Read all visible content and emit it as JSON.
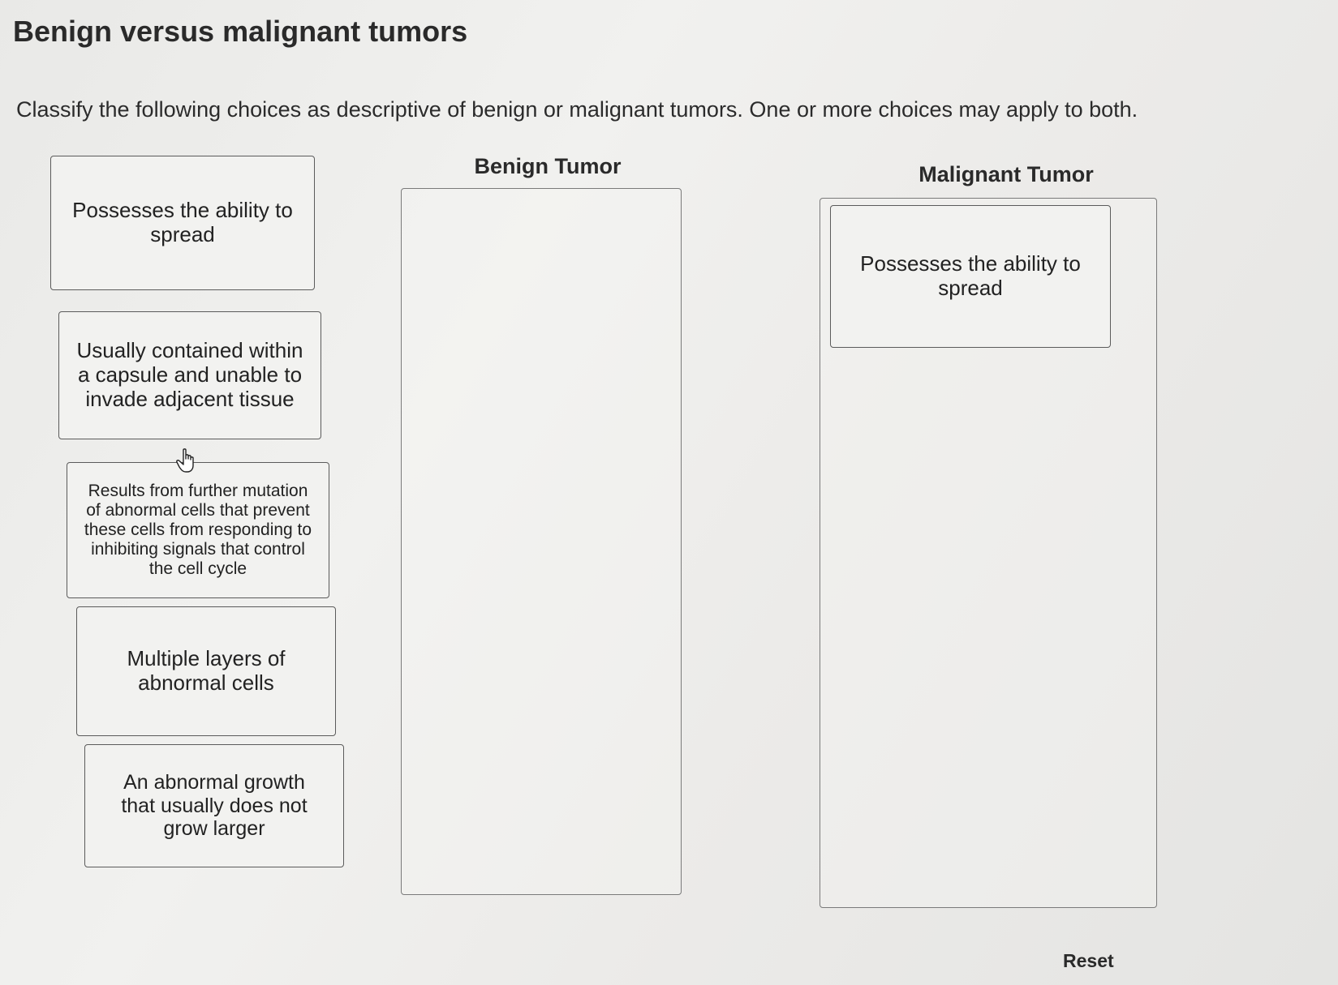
{
  "title": "Benign versus malignant tumors",
  "instructions": "Classify the following choices as descriptive of benign or malignant tumors. One or more choices may apply to both.",
  "choices": [
    {
      "text": "Possesses the ability to spread"
    },
    {
      "text": "Usually contained within a capsule and unable to invade adjacent tissue"
    },
    {
      "text": "Results from further mutation of abnormal cells that prevent these cells from responding to inhibiting signals that control the cell cycle"
    },
    {
      "text": "Multiple layers of abnormal cells"
    },
    {
      "text": "An abnormal growth that usually does not grow larger"
    }
  ],
  "columns": {
    "benign": {
      "label": "Benign Tumor",
      "items": []
    },
    "malignant": {
      "label": "Malignant Tumor",
      "items": [
        {
          "text": "Possesses the ability to spread"
        }
      ]
    }
  },
  "reset_label": "Reset",
  "cursor_icon": "hand-pointer-icon"
}
